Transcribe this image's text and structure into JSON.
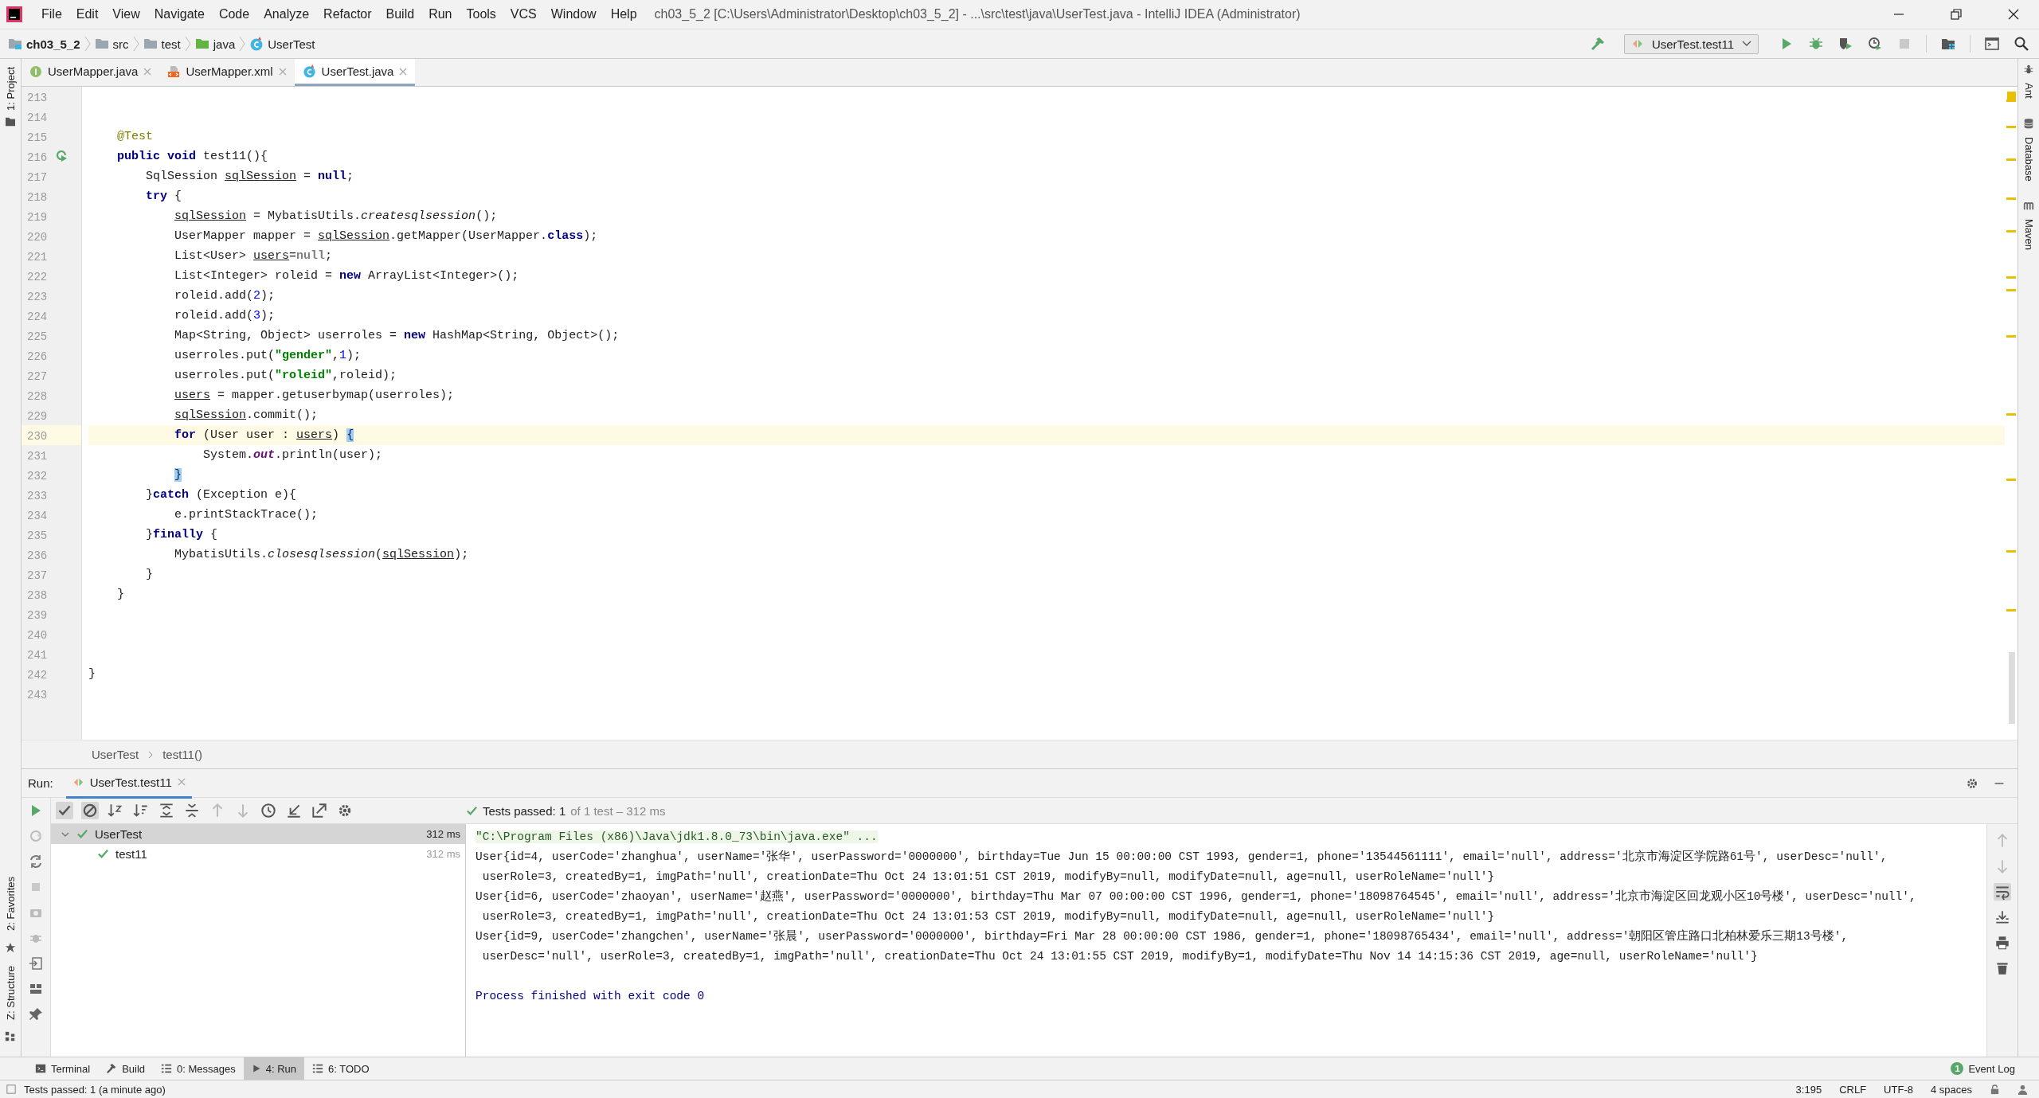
{
  "window": {
    "title": "ch03_5_2 [C:\\Users\\Administrator\\Desktop\\ch03_5_2] - ...\\src\\test\\java\\UserTest.java - IntelliJ IDEA (Administrator)"
  },
  "menu": [
    "File",
    "Edit",
    "View",
    "Navigate",
    "Code",
    "Analyze",
    "Refactor",
    "Build",
    "Run",
    "Tools",
    "VCS",
    "Window",
    "Help"
  ],
  "nav": {
    "crumbs": [
      {
        "label": "ch03_5_2",
        "kind": "module"
      },
      {
        "label": "src",
        "kind": "folder"
      },
      {
        "label": "test",
        "kind": "folder"
      },
      {
        "label": "java",
        "kind": "source"
      },
      {
        "label": "UserTest",
        "kind": "class"
      }
    ],
    "run_config": "UserTest.test11"
  },
  "left_tools": {
    "top": [
      "1: Project"
    ],
    "bottom": [
      "2: Favorites",
      "Z: Structure"
    ]
  },
  "right_tools": [
    {
      "label": "Ant",
      "kind": "ant"
    },
    {
      "label": "Database",
      "kind": "database"
    },
    {
      "label": "Maven",
      "kind": "maven"
    }
  ],
  "editor_tabs": [
    {
      "label": "UserMapper.java",
      "kind": "interface",
      "selected": false
    },
    {
      "label": "UserMapper.xml",
      "kind": "xml",
      "selected": false
    },
    {
      "label": "UserTest.java",
      "kind": "class",
      "selected": true
    }
  ],
  "code_lines": [
    {
      "no": "213",
      "current": false,
      "run_marker": false
    },
    {
      "no": "214",
      "current": false,
      "run_marker": false
    },
    {
      "no": "215",
      "current": false,
      "run_marker": false,
      "tokens": [
        {
          "kind": "annotation",
          "text": "    @Test"
        }
      ]
    },
    {
      "no": "216",
      "current": false,
      "run_marker": true,
      "tokens": [
        {
          "kind": "keyword",
          "text": "    public"
        },
        {
          "kind": "keyword",
          "text": " void"
        },
        {
          "kind": "plain",
          "text": " test11(){"
        }
      ]
    },
    {
      "no": "217",
      "current": false,
      "run_marker": false,
      "tokens": [
        {
          "kind": "plain",
          "text": "        SqlSession "
        },
        {
          "kind": "var",
          "text": "sqlSession"
        },
        {
          "kind": "plain",
          "text": " = "
        },
        {
          "kind": "keyword",
          "text": "null"
        },
        {
          "kind": "plain",
          "text": ";"
        }
      ]
    },
    {
      "no": "218",
      "current": false,
      "run_marker": false,
      "tokens": [
        {
          "kind": "keyword",
          "text": "        try"
        },
        {
          "kind": "plain",
          "text": " {"
        }
      ]
    },
    {
      "no": "219",
      "current": false,
      "run_marker": false,
      "tokens": [
        {
          "kind": "var",
          "text": "            sqlSession"
        },
        {
          "kind": "plain",
          "text": " = MybatisUtils."
        },
        {
          "kind": "static",
          "text": "createsqlsession"
        },
        {
          "kind": "plain",
          "text": "();"
        }
      ]
    },
    {
      "no": "220",
      "current": false,
      "run_marker": false,
      "tokens": [
        {
          "kind": "plain",
          "text": "            UserMapper mapper = "
        },
        {
          "kind": "var",
          "text": "sqlSession"
        },
        {
          "kind": "plain",
          "text": ".getMapper(UserMapper."
        },
        {
          "kind": "keyword",
          "text": "class"
        },
        {
          "kind": "plain",
          "text": ");"
        }
      ]
    },
    {
      "no": "221",
      "current": false,
      "run_marker": false,
      "tokens": [
        {
          "kind": "plain",
          "text": "            List<User> "
        },
        {
          "kind": "var",
          "text": "users"
        },
        {
          "kind": "plain",
          "text": "="
        },
        {
          "kind": "dim",
          "text": "null"
        },
        {
          "kind": "plain",
          "text": ";"
        }
      ]
    },
    {
      "no": "222",
      "current": false,
      "run_marker": false,
      "tokens": [
        {
          "kind": "plain",
          "text": "            List<Integer> roleid = "
        },
        {
          "kind": "keyword",
          "text": "new"
        },
        {
          "kind": "plain",
          "text": " ArrayList<Integer>();"
        }
      ]
    },
    {
      "no": "223",
      "current": false,
      "run_marker": false,
      "tokens": [
        {
          "kind": "plain",
          "text": "            roleid.add("
        },
        {
          "kind": "number",
          "text": "2"
        },
        {
          "kind": "plain",
          "text": ");"
        }
      ]
    },
    {
      "no": "224",
      "current": false,
      "run_marker": false,
      "tokens": [
        {
          "kind": "plain",
          "text": "            roleid.add("
        },
        {
          "kind": "number",
          "text": "3"
        },
        {
          "kind": "plain",
          "text": ");"
        }
      ]
    },
    {
      "no": "225",
      "current": false,
      "run_marker": false,
      "tokens": [
        {
          "kind": "plain",
          "text": "            Map<String, Object> userroles = "
        },
        {
          "kind": "keyword",
          "text": "new"
        },
        {
          "kind": "plain",
          "text": " HashMap<String, Object>();"
        }
      ]
    },
    {
      "no": "226",
      "current": false,
      "run_marker": false,
      "tokens": [
        {
          "kind": "plain",
          "text": "            userroles.put("
        },
        {
          "kind": "string",
          "text": "\"gender\""
        },
        {
          "kind": "plain",
          "text": ","
        },
        {
          "kind": "number",
          "text": "1"
        },
        {
          "kind": "plain",
          "text": ");"
        }
      ]
    },
    {
      "no": "227",
      "current": false,
      "run_marker": false,
      "tokens": [
        {
          "kind": "plain",
          "text": "            userroles.put("
        },
        {
          "kind": "string",
          "text": "\"roleid\""
        },
        {
          "kind": "plain",
          "text": ",roleid);"
        }
      ]
    },
    {
      "no": "228",
      "current": false,
      "run_marker": false,
      "tokens": [
        {
          "kind": "var",
          "text": "            users"
        },
        {
          "kind": "plain",
          "text": " = mapper.getuserbymap(userroles);"
        }
      ]
    },
    {
      "no": "229",
      "current": false,
      "run_marker": false,
      "tokens": [
        {
          "kind": "var",
          "text": "            sqlSession"
        },
        {
          "kind": "plain",
          "text": ".commit();"
        }
      ]
    },
    {
      "no": "230",
      "current": true,
      "run_marker": false,
      "tokens": [
        {
          "kind": "keyword",
          "text": "            for"
        },
        {
          "kind": "plain",
          "text": " (User user : "
        },
        {
          "kind": "var",
          "text": "users"
        },
        {
          "kind": "plain",
          "text": ")"
        },
        {
          "kind": "brace",
          "text": " {"
        }
      ]
    },
    {
      "no": "231",
      "current": false,
      "run_marker": false,
      "tokens": [
        {
          "kind": "plain",
          "text": "                System."
        },
        {
          "kind": "field",
          "text": "out"
        },
        {
          "kind": "plain",
          "text": ".println(user);"
        }
      ]
    },
    {
      "no": "232",
      "current": false,
      "run_marker": false,
      "tokens": [
        {
          "kind": "brace",
          "text": "            }"
        }
      ]
    },
    {
      "no": "233",
      "current": false,
      "run_marker": false,
      "tokens": [
        {
          "kind": "plain",
          "text": "        }"
        },
        {
          "kind": "keyword",
          "text": "catch"
        },
        {
          "kind": "plain",
          "text": " (Exception e){"
        }
      ]
    },
    {
      "no": "234",
      "current": false,
      "run_marker": false,
      "tokens": [
        {
          "kind": "plain",
          "text": "            e.printStackTrace();"
        }
      ]
    },
    {
      "no": "235",
      "current": false,
      "run_marker": false,
      "tokens": [
        {
          "kind": "plain",
          "text": "        }"
        },
        {
          "kind": "keyword",
          "text": "finally"
        },
        {
          "kind": "plain",
          "text": " {"
        }
      ]
    },
    {
      "no": "236",
      "current": false,
      "run_marker": false,
      "tokens": [
        {
          "kind": "plain",
          "text": "            MybatisUtils."
        },
        {
          "kind": "static",
          "text": "closesqlsession"
        },
        {
          "kind": "plain",
          "text": "("
        },
        {
          "kind": "var",
          "text": "sqlSession"
        },
        {
          "kind": "plain",
          "text": ");"
        }
      ]
    },
    {
      "no": "237",
      "current": false,
      "run_marker": false,
      "tokens": [
        {
          "kind": "plain",
          "text": "        }"
        }
      ]
    },
    {
      "no": "238",
      "current": false,
      "run_marker": false,
      "tokens": [
        {
          "kind": "plain",
          "text": "    }"
        }
      ]
    },
    {
      "no": "239",
      "current": false,
      "run_marker": false
    },
    {
      "no": "240",
      "current": false,
      "run_marker": false
    },
    {
      "no": "241",
      "current": false,
      "run_marker": false
    },
    {
      "no": "242",
      "current": false,
      "run_marker": false,
      "tokens": [
        {
          "kind": "plain",
          "text": "}"
        }
      ]
    },
    {
      "no": "243",
      "current": false,
      "run_marker": false
    }
  ],
  "breadcrumb": [
    "UserTest",
    "test11()"
  ],
  "run": {
    "label": "Run:",
    "tab": "UserTest.test11",
    "status": "Tests passed: 1",
    "status_detail": "of 1 test – 312 ms",
    "tree": [
      {
        "label": "UserTest",
        "time": "312 ms",
        "selected": true,
        "expanded": true,
        "children": [
          {
            "label": "test11",
            "time": "312 ms",
            "selected": false
          }
        ]
      }
    ],
    "console": [
      {
        "kind": "command",
        "text": "\"C:\\Program Files (x86)\\Java\\jdk1.8.0_73\\bin\\java.exe\" ..."
      },
      {
        "kind": "output",
        "text": "User{id=4, userCode='zhanghua', userName='张华', userPassword='0000000', birthday=Tue Jun 15 00:00:00 CST 1993, gender=1, phone='13544561111', email='null', address='北京市海淀区学院路61号', userDesc='null',"
      },
      {
        "kind": "output",
        "text": " userRole=3, createdBy=1, imgPath='null', creationDate=Thu Oct 24 13:01:51 CST 2019, modifyBy=null, modifyDate=null, age=null, userRoleName='null'}"
      },
      {
        "kind": "output",
        "text": "User{id=6, userCode='zhaoyan', userName='赵燕', userPassword='0000000', birthday=Thu Mar 07 00:00:00 CST 1996, gender=1, phone='18098764545', email='null', address='北京市海淀区回龙观小区10号楼', userDesc='null',"
      },
      {
        "kind": "output",
        "text": " userRole=3, createdBy=1, imgPath='null', creationDate=Thu Oct 24 13:01:53 CST 2019, modifyBy=null, modifyDate=null, age=null, userRoleName='null'}"
      },
      {
        "kind": "output",
        "text": "User{id=9, userCode='zhangchen', userName='张晨', userPassword='0000000', birthday=Fri Mar 28 00:00:00 CST 1986, gender=1, phone='18098765434', email='null', address='朝阳区管庄路口北柏林爱乐三期13号楼',"
      },
      {
        "kind": "output",
        "text": " userDesc='null', userRole=3, createdBy=1, imgPath='null', creationDate=Thu Oct 24 13:01:55 CST 2019, modifyBy=1, modifyDate=Thu Nov 14 14:15:36 CST 2019, age=null, userRoleName='null'}"
      },
      {
        "kind": "info",
        "text": "Process finished with exit code 0"
      }
    ]
  },
  "bottom_tabs": [
    {
      "label": "Terminal",
      "kind": "terminal",
      "selected": false
    },
    {
      "label": "Build",
      "kind": "build",
      "selected": false
    },
    {
      "label": "0: Messages",
      "kind": "messages",
      "selected": false
    },
    {
      "label": "4: Run",
      "kind": "run",
      "selected": true
    },
    {
      "label": "6: TODO",
      "kind": "todo",
      "selected": false
    }
  ],
  "event_log": {
    "label": "Event Log",
    "count": "1"
  },
  "status_bar": {
    "message": "Tests passed: 1 (a minute ago)",
    "position": "3:195",
    "line_ending": "CRLF",
    "encoding": "UTF-8",
    "indent": "4 spaces"
  }
}
